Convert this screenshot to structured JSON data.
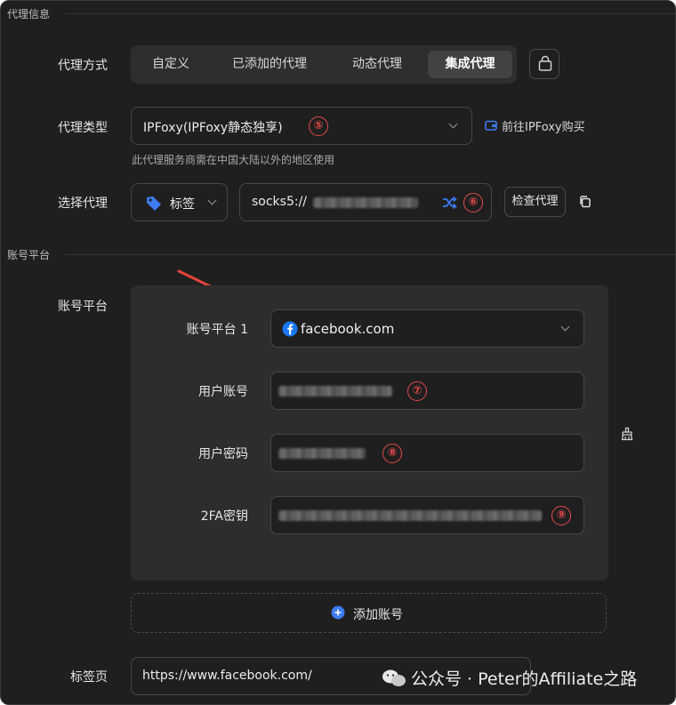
{
  "sections": {
    "proxy_info": "代理信息",
    "account_platform": "账号平台"
  },
  "proxy_method": {
    "label": "代理方式",
    "options": [
      "自定义",
      "已添加的代理",
      "动态代理",
      "集成代理"
    ],
    "selected": "集成代理"
  },
  "proxy_type": {
    "label": "代理类型",
    "value": "IPFoxy(IPFoxy静态独享)",
    "badge": "⑤",
    "buy_link": "前往IPFoxy购买",
    "hint": "此代理服务商需在中国大陆以外的地区使用"
  },
  "select_proxy": {
    "label": "选择代理",
    "tag_value": "标签",
    "proxy_value": "socks5://",
    "badge": "⑥",
    "check_button": "检查代理"
  },
  "account": {
    "label": "账号平台",
    "platform_label": "账号平台 1",
    "platform_value": "facebook.com",
    "username_label": "用户账号",
    "username_badge": "⑦",
    "password_label": "用户密码",
    "password_badge": "⑧",
    "twofa_label": "2FA密钥",
    "twofa_badge": "⑨",
    "add_button": "添加账号"
  },
  "tab_page": {
    "label": "标签页",
    "value": "https://www.facebook.com/"
  },
  "watermark": {
    "text": "公众号 · Peter的Affiliate之路"
  },
  "colors": {
    "accent_blue": "#3d7bf0",
    "annotation_red": "#e44a4a"
  }
}
